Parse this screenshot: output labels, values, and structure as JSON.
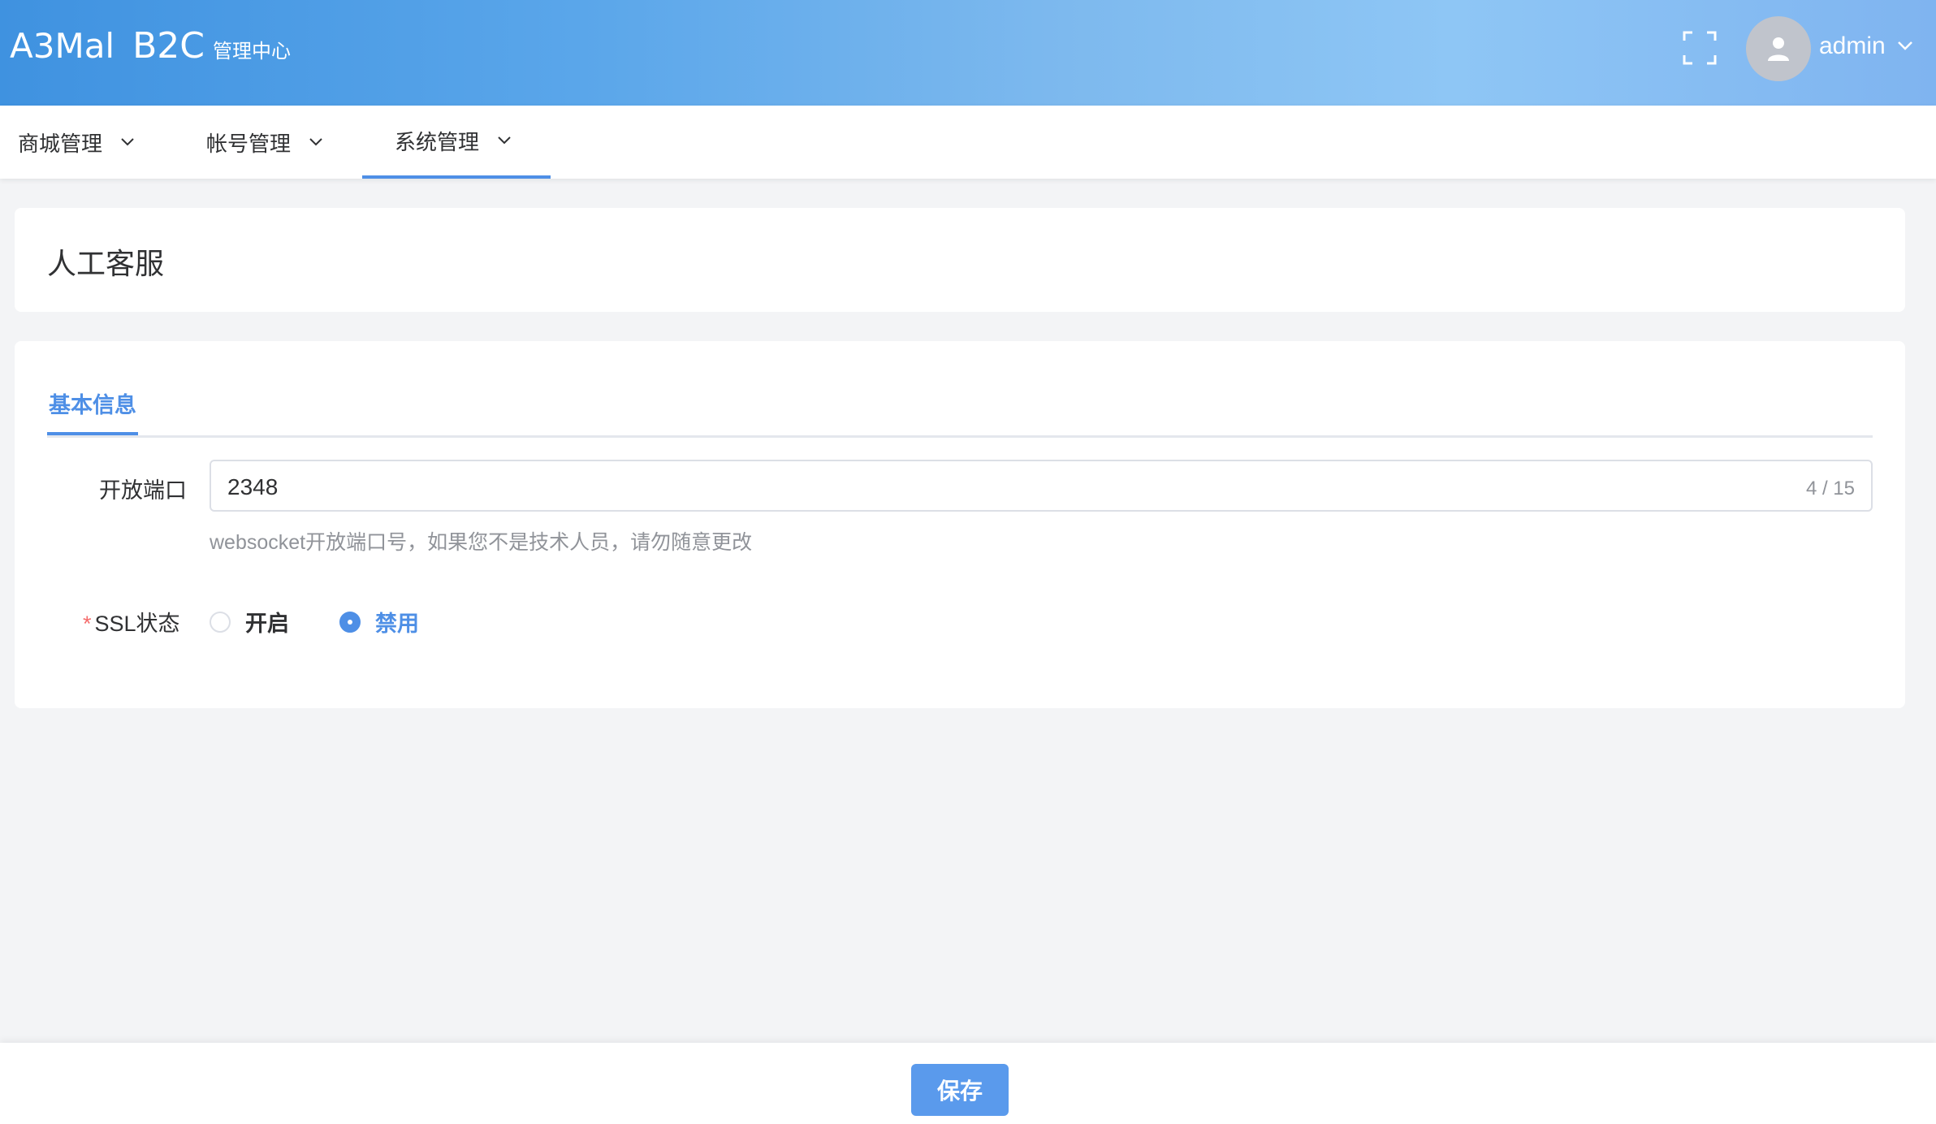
{
  "header": {
    "logo_mark": "A3Mal",
    "logo_product": "B2C",
    "logo_subtitle": "管理中心",
    "fullscreen_icon": "fullscreen-icon",
    "avatar_icon": "user-icon",
    "username": "admin",
    "user_menu_icon": "chevron-down-icon"
  },
  "nav": {
    "items": [
      {
        "label": "商城管理",
        "icon": "chevron-down-icon"
      },
      {
        "label": "帐号管理",
        "icon": "chevron-down-icon"
      },
      {
        "label": "系统管理",
        "icon": "chevron-down-icon",
        "active": true
      }
    ]
  },
  "page": {
    "title": "人工客服"
  },
  "form": {
    "tab_label": "基本信息",
    "port": {
      "label": "开放端口",
      "value": "2348",
      "count": "4 / 15",
      "hint": "websocket开放端口号，如果您不是技术人员，请勿随意更改"
    },
    "ssl": {
      "required_mark": "*",
      "label": "SSL状态",
      "options": [
        {
          "label": "开启",
          "checked": false
        },
        {
          "label": "禁用",
          "checked": true
        }
      ]
    }
  },
  "footer": {
    "save_label": "保存"
  },
  "colors": {
    "accent": "#4e8fe6",
    "required": "#f56c6c",
    "header_gradient_start": "#3f92e0",
    "header_gradient_end": "#7fb4f0"
  }
}
